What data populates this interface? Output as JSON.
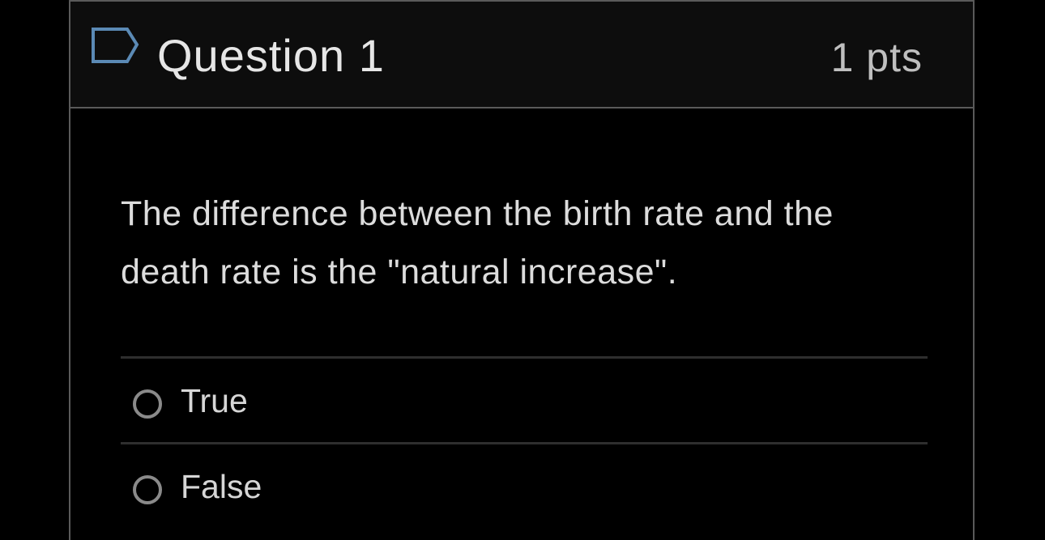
{
  "question": {
    "title": "Question 1",
    "points": "1 pts",
    "text": "The difference between the birth rate and the death rate is the \"natural increase\".",
    "flag_icon": "flag-bookmark-icon"
  },
  "answers": [
    {
      "label": "True",
      "selected": false
    },
    {
      "label": "False",
      "selected": false
    }
  ],
  "colors": {
    "background": "#000000",
    "header_background": "#0d0d0d",
    "border": "#5a5a5a",
    "text": "#dcdcdc",
    "flag_accent": "#5b8ab5"
  }
}
